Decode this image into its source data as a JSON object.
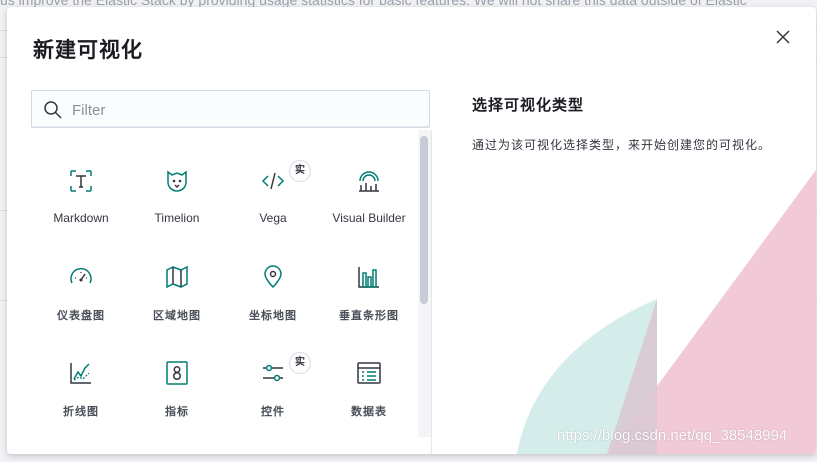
{
  "background": {
    "banner_text": "us improve the Elastic Stack by providing usage statistics for basic features. We will not share this data outside of Elastic"
  },
  "modal": {
    "title": "新建可视化",
    "close_icon": "close-icon"
  },
  "search": {
    "placeholder": "Filter",
    "value": ""
  },
  "tiles": [
    {
      "label": "Markdown",
      "icon": "markdown-icon",
      "badge": ""
    },
    {
      "label": "Timelion",
      "icon": "timelion-icon",
      "badge": ""
    },
    {
      "label": "Vega",
      "icon": "code-icon",
      "badge": "实"
    },
    {
      "label": "Visual Builder",
      "icon": "visual-builder-icon",
      "badge": ""
    },
    {
      "label": "仪表盘图",
      "icon": "gauge-icon",
      "badge": ""
    },
    {
      "label": "区域地图",
      "icon": "region-map-icon",
      "badge": ""
    },
    {
      "label": "坐标地图",
      "icon": "map-pin-icon",
      "badge": ""
    },
    {
      "label": "垂直条形图",
      "icon": "vertical-bar-icon",
      "badge": ""
    },
    {
      "label": "折线图",
      "icon": "line-chart-icon",
      "badge": ""
    },
    {
      "label": "指标",
      "icon": "metric-icon",
      "badge": ""
    },
    {
      "label": "控件",
      "icon": "controls-icon",
      "badge": "实"
    },
    {
      "label": "数据表",
      "icon": "data-table-icon",
      "badge": ""
    }
  ],
  "description": {
    "title": "选择可视化类型",
    "text": "通过为该可视化选择类型，来开始创建您的可视化。"
  },
  "watermark": "https://blog.csdn.net/qq_38548994",
  "colors": {
    "accent": "#017d73",
    "pink": "#f0c3d3",
    "teal": "#cde9e6"
  }
}
